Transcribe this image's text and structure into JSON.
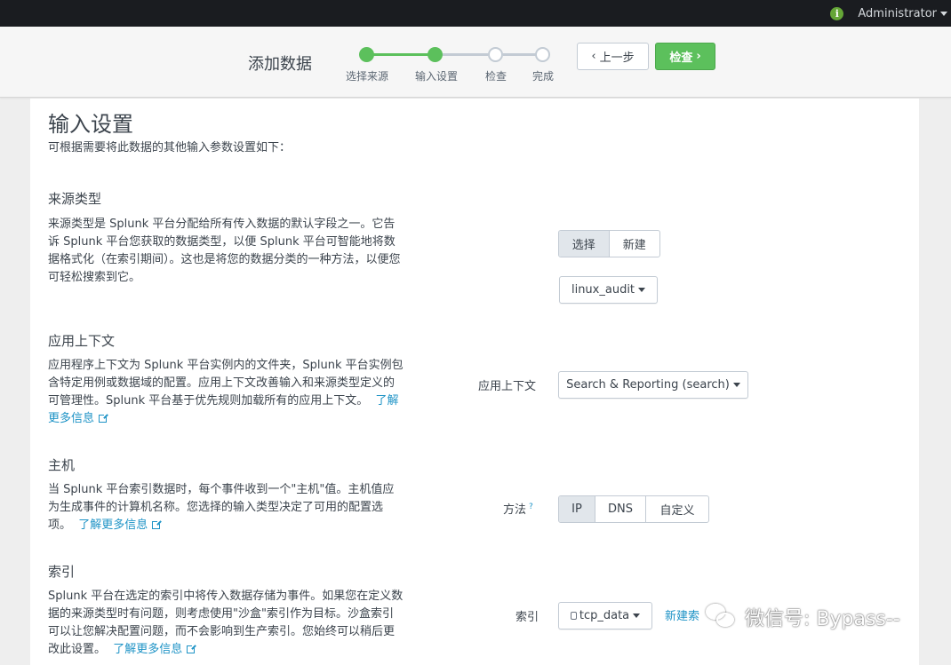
{
  "topbar": {
    "user": "Administrator",
    "info_icon": "i"
  },
  "wizard": {
    "title": "添加数据",
    "steps": [
      {
        "label": "选择来源",
        "state": "done"
      },
      {
        "label": "输入设置",
        "state": "done"
      },
      {
        "label": "检查",
        "state": "todo"
      },
      {
        "label": "完成",
        "state": "todo"
      }
    ],
    "back_label": "上一步",
    "next_label": "检查"
  },
  "page": {
    "title": "输入设置",
    "intro": "可根据需要将此数据的其他输入参数设置如下："
  },
  "sourcetype": {
    "title": "来源类型",
    "desc": "来源类型是 Splunk 平台分配给所有传入数据的默认字段之一。它告诉 Splunk 平台您获取的数据类型，以便 Splunk 平台可智能地将数据格式化（在索引期间）。这也是将您的数据分类的一种方法，以便您可轻松搜索到它。",
    "tabs": [
      "选择",
      "新建"
    ],
    "active_tab": "选择",
    "selected": "linux_audit"
  },
  "app_context": {
    "title": "应用上下文",
    "desc": "应用程序上下文为 Splunk 平台实例内的文件夹，Splunk 平台实例包含特定用例或数据域的配置。应用上下文改善输入和来源类型定义的可管理性。Splunk 平台基于优先规则加载所有的应用上下文。",
    "link": "了解更多信息",
    "label": "应用上下文",
    "selected": "Search & Reporting (search)"
  },
  "host": {
    "title": "主机",
    "desc": "当 Splunk 平台索引数据时，每个事件收到一个\"主机\"值。主机值应为生成事件的计算机名称。您选择的输入类型决定了可用的配置选项。",
    "link": "了解更多信息",
    "label": "方法",
    "help": "?",
    "options": [
      "IP",
      "DNS",
      "自定义"
    ],
    "active_option": "IP"
  },
  "index": {
    "title": "索引",
    "desc": "Splunk 平台在选定的索引中将传入数据存储为事件。如果您在定义数据的来源类型时有问题，则考虑使用\"沙盒\"索引作为目标。沙盒索引可以让您解决配置问题，而不会影响到生产索引。您始终可以稍后更改此设置。",
    "link": "了解更多信息",
    "label": "索引",
    "selected": "tcp_data",
    "new_index": "新建索"
  },
  "watermark": {
    "text": "微信号: Bypass--"
  },
  "colors": {
    "accent_green": "#5cc05c",
    "link_blue": "#1e93c6",
    "topbar": "#1a1c20"
  }
}
